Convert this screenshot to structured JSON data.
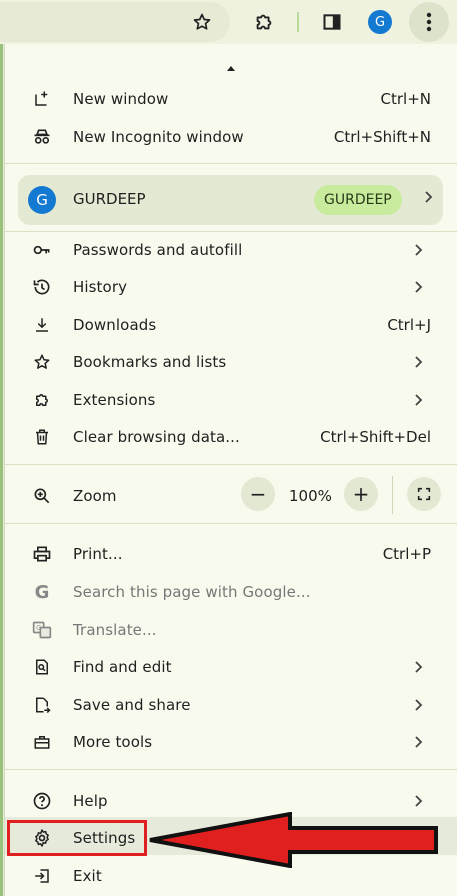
{
  "toolbar": {
    "profile_initial": "G"
  },
  "menu": {
    "new_window": {
      "label": "New window",
      "shortcut": "Ctrl+N"
    },
    "new_incognito": {
      "label": "New Incognito window",
      "shortcut": "Ctrl+Shift+N"
    },
    "profile": {
      "initial": "G",
      "name": "GURDEEP",
      "badge": "GURDEEP"
    },
    "passwords": {
      "label": "Passwords and autofill"
    },
    "history": {
      "label": "History"
    },
    "downloads": {
      "label": "Downloads",
      "shortcut": "Ctrl+J"
    },
    "bookmarks": {
      "label": "Bookmarks and lists"
    },
    "extensions": {
      "label": "Extensions"
    },
    "clear_data": {
      "label": "Clear browsing data...",
      "shortcut": "Ctrl+Shift+Del"
    },
    "zoom": {
      "label": "Zoom",
      "value": "100%",
      "minus": "−",
      "plus": "+"
    },
    "print": {
      "label": "Print...",
      "shortcut": "Ctrl+P"
    },
    "search_google": {
      "label": "Search this page with Google..."
    },
    "translate": {
      "label": "Translate..."
    },
    "find_edit": {
      "label": "Find and edit"
    },
    "save_share": {
      "label": "Save and share"
    },
    "more_tools": {
      "label": "More tools"
    },
    "help": {
      "label": "Help"
    },
    "settings": {
      "label": "Settings"
    },
    "exit": {
      "label": "Exit"
    }
  },
  "colors": {
    "accent_avatar": "#1479d1",
    "badge": "#c9eb9e",
    "annotation_red": "#e02020"
  }
}
